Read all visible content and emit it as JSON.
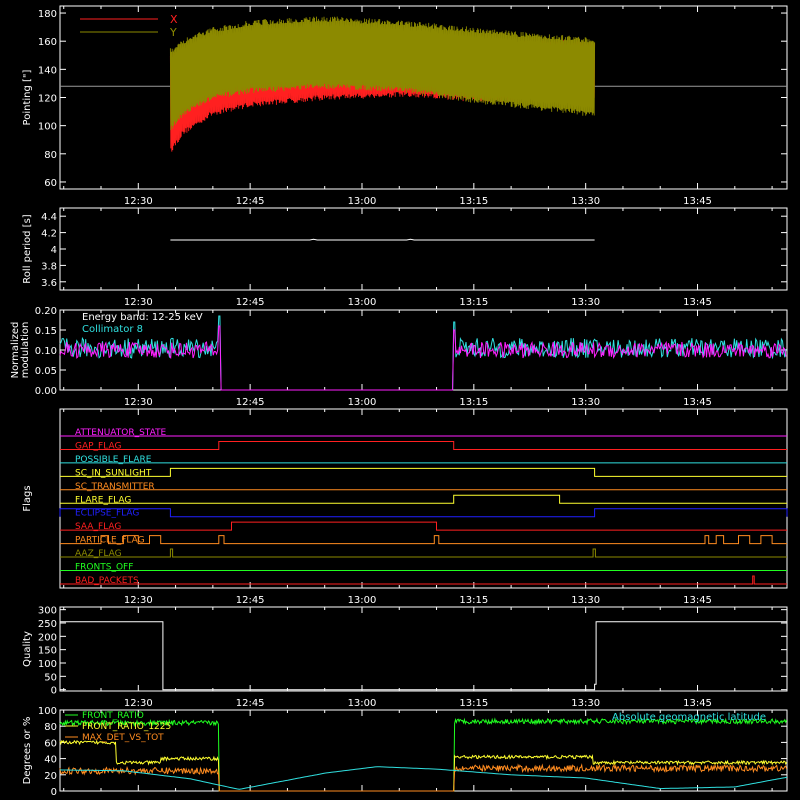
{
  "time_axis": {
    "ticks": [
      "12:30",
      "12:45",
      "13:00",
      "13:15",
      "13:30",
      "13:45"
    ],
    "tick_minutes": [
      30,
      45,
      60,
      75,
      90,
      105
    ],
    "range_minutes": [
      19.5,
      117
    ],
    "reference": "12:00"
  },
  "colors": {
    "background": "#000000",
    "axes": "#ffffff",
    "red": "#ff2020",
    "olive": "#8c8a00",
    "cyan": "#30e0e0",
    "magenta": "#ff20ff",
    "yellow": "#ffff30",
    "orange": "#ff8c20",
    "green": "#20ff20",
    "blue": "#2020ff"
  },
  "chart_data": [
    {
      "type": "line",
      "panel": "pointing",
      "ylabel": "Pointing [\"]",
      "ylim": [
        55,
        185
      ],
      "yticks": [
        60,
        80,
        100,
        120,
        140,
        160,
        180
      ],
      "legend": [
        "X",
        "Y"
      ],
      "reference_line": 128,
      "active_range_minutes": [
        34.3,
        91.2
      ],
      "series": [
        {
          "name": "X",
          "color": "red",
          "envelope_minutes": [
            34.3,
            36,
            40,
            45,
            55,
            65,
            75,
            85,
            91.2
          ],
          "upper": [
            150,
            158,
            163,
            166,
            168,
            166,
            163,
            161,
            160
          ],
          "lower": [
            80,
            93,
            107,
            113,
            118,
            120,
            117,
            116,
            118
          ]
        },
        {
          "name": "Y",
          "color": "olive",
          "envelope_minutes": [
            34.3,
            36,
            40,
            45,
            55,
            65,
            75,
            85,
            91.2
          ],
          "upper": [
            155,
            162,
            170,
            175,
            178,
            175,
            170,
            165,
            163
          ],
          "lower": [
            95,
            107,
            118,
            123,
            126,
            124,
            116,
            110,
            106
          ]
        }
      ]
    },
    {
      "type": "line",
      "panel": "roll-period",
      "ylabel": "Roll period [s]",
      "ylim": [
        3.5,
        4.5
      ],
      "yticks": [
        3.6,
        3.8,
        4.0,
        4.2,
        4.4
      ],
      "series": [
        {
          "name": "",
          "color": "axes",
          "x": [
            34.3,
            53,
            53.5,
            54,
            61,
            66,
            66.5,
            67,
            91.2
          ],
          "y": [
            4.11,
            4.11,
            4.12,
            4.11,
            4.11,
            4.11,
            4.12,
            4.11,
            4.11
          ]
        }
      ]
    },
    {
      "type": "line",
      "panel": "modulation",
      "ylabel": [
        "Normalized",
        "modulation"
      ],
      "ylim": [
        0.0,
        0.2
      ],
      "yticks": [
        "0.00",
        "0.05",
        "0.10",
        "0.15",
        "0.20"
      ],
      "annotations": [
        "Energy band: 12-25 keV",
        "Collimator 8"
      ],
      "gaps_minutes": [
        [
          40.8,
          72.3
        ]
      ],
      "series": [
        {
          "name": "",
          "color": "cyan",
          "mean": 0.105,
          "noise": 0.025
        },
        {
          "name": "Collimator 8",
          "color": "magenta",
          "mean": 0.1,
          "noise": 0.02
        }
      ]
    },
    {
      "type": "line",
      "panel": "flags",
      "ylabel": "Flags",
      "flags": [
        {
          "label": "ATTENUATOR_STATE",
          "color": "magenta",
          "on": []
        },
        {
          "label": "GAP_FLAG",
          "color": "red",
          "on": [
            [
              40.8,
              72.3
            ]
          ]
        },
        {
          "label": "POSSIBLE_FLARE",
          "color": "cyan",
          "on": []
        },
        {
          "label": "SC_IN_SUNLIGHT",
          "color": "yellow",
          "on": [
            [
              34.3,
              91.2
            ]
          ]
        },
        {
          "label": "SC_TRANSMITTER",
          "color": "orange",
          "on": []
        },
        {
          "label": "FLARE_FLAG",
          "color": "yellow",
          "on": [
            [
              72.3,
              86.5
            ]
          ]
        },
        {
          "label": "ECLIPSE_FLAG",
          "color": "blue",
          "on": [
            [
              19.5,
              34.3
            ],
            [
              91.2,
              117
            ]
          ]
        },
        {
          "label": "SAA_FLAG",
          "color": "red",
          "on": [
            [
              42.5,
              70.0
            ]
          ]
        },
        {
          "label": "PARTICLE_FLAG",
          "color": "orange",
          "on": [
            [
              25,
              26
            ],
            [
              28,
              30
            ],
            [
              31.5,
              33
            ],
            [
              40.8,
              41.5
            ],
            [
              69.7,
              70.3
            ],
            [
              106,
              106.5
            ],
            [
              107.5,
              108.5
            ],
            [
              110.5,
              112
            ],
            [
              113.5,
              115
            ]
          ]
        },
        {
          "label": "AAZ_FLAG",
          "color": "olive",
          "on": [
            [
              34.3,
              34.6
            ],
            [
              91.0,
              91.3
            ]
          ]
        },
        {
          "label": "FRONTS_OFF",
          "color": "green",
          "on": []
        },
        {
          "label": "BAD_PACKETS",
          "color": "red",
          "on": [
            [
              112.4,
              112.6
            ]
          ]
        }
      ]
    },
    {
      "type": "line",
      "panel": "quality",
      "ylabel": "Quality",
      "ylim": [
        -5,
        310
      ],
      "yticks": [
        0,
        50,
        100,
        150,
        200,
        250,
        300
      ],
      "series": [
        {
          "name": "",
          "color": "axes",
          "x": [
            19.5,
            33.3,
            33.3,
            91.2,
            91.2,
            91.4,
            91.4,
            117
          ],
          "y": [
            255,
            255,
            0,
            0,
            20,
            20,
            255,
            255
          ]
        }
      ]
    },
    {
      "type": "line",
      "panel": "ratios",
      "ylabel": "Degrees or %",
      "ylim": [
        0,
        100
      ],
      "yticks": [
        0,
        20,
        40,
        60,
        80,
        100
      ],
      "legend": [
        "FRONT_RATIO",
        "FRONT_RATIO_1225",
        "MAX_DET_VS_TOT"
      ],
      "right_label": "Absolute geomagnetic latitude",
      "gaps_minutes": [
        [
          40.8,
          72.3
        ]
      ],
      "series": [
        {
          "name": "FRONT_RATIO",
          "color": "green",
          "segments": [
            [
              19.5,
              40.8,
              84
            ],
            [
              72.3,
              117,
              86
            ]
          ],
          "noise": 3
        },
        {
          "name": "FRONT_RATIO_1225",
          "color": "yellow",
          "segments": [
            [
              19.5,
              27,
              60
            ],
            [
              27,
              33,
              35
            ],
            [
              33,
              40.8,
              40
            ],
            [
              72.3,
              91,
              42
            ],
            [
              91,
              117,
              35
            ]
          ],
          "noise": 2
        },
        {
          "name": "MAX_DET_VS_TOT",
          "color": "orange",
          "segments": [
            [
              19.5,
              40.8,
              25
            ],
            [
              72.3,
              117,
              28
            ]
          ],
          "noise": 4
        },
        {
          "name": "Absolute geomagnetic latitude",
          "color": "cyan",
          "x": [
            19.5,
            28,
            37,
            43.5,
            55,
            62,
            70,
            80,
            90,
            100,
            110,
            117
          ],
          "y": [
            26,
            25,
            15,
            2,
            22,
            30,
            27,
            20,
            16,
            3,
            5,
            17
          ]
        }
      ]
    }
  ]
}
